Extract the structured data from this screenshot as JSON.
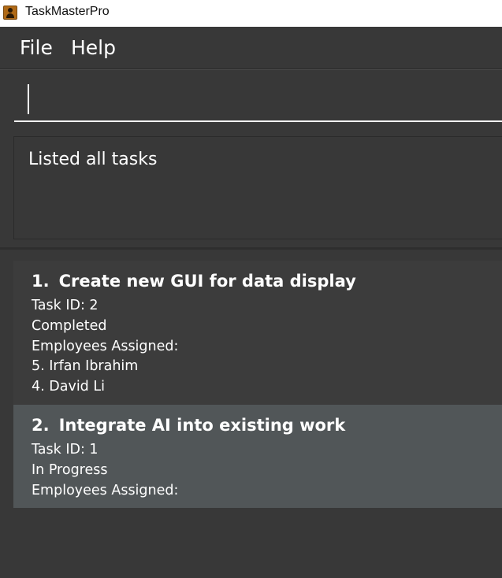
{
  "window": {
    "title": "TaskMasterPro"
  },
  "menubar": {
    "items": [
      "File",
      "Help"
    ]
  },
  "command": {
    "value": ""
  },
  "result": {
    "text": "Listed all tasks"
  },
  "tasks": [
    {
      "index": "1.",
      "name": "Create new GUI for data display",
      "task_id": "Task ID: 2",
      "status": "Completed",
      "employees_label": "Employees Assigned:",
      "employees": [
        "5. Irfan Ibrahim",
        "4. David Li"
      ]
    },
    {
      "index": "2.",
      "name": "Integrate AI into existing work",
      "task_id": "Task ID: 1",
      "status": "In Progress",
      "employees_label": "Employees Assigned:",
      "employees": []
    }
  ]
}
